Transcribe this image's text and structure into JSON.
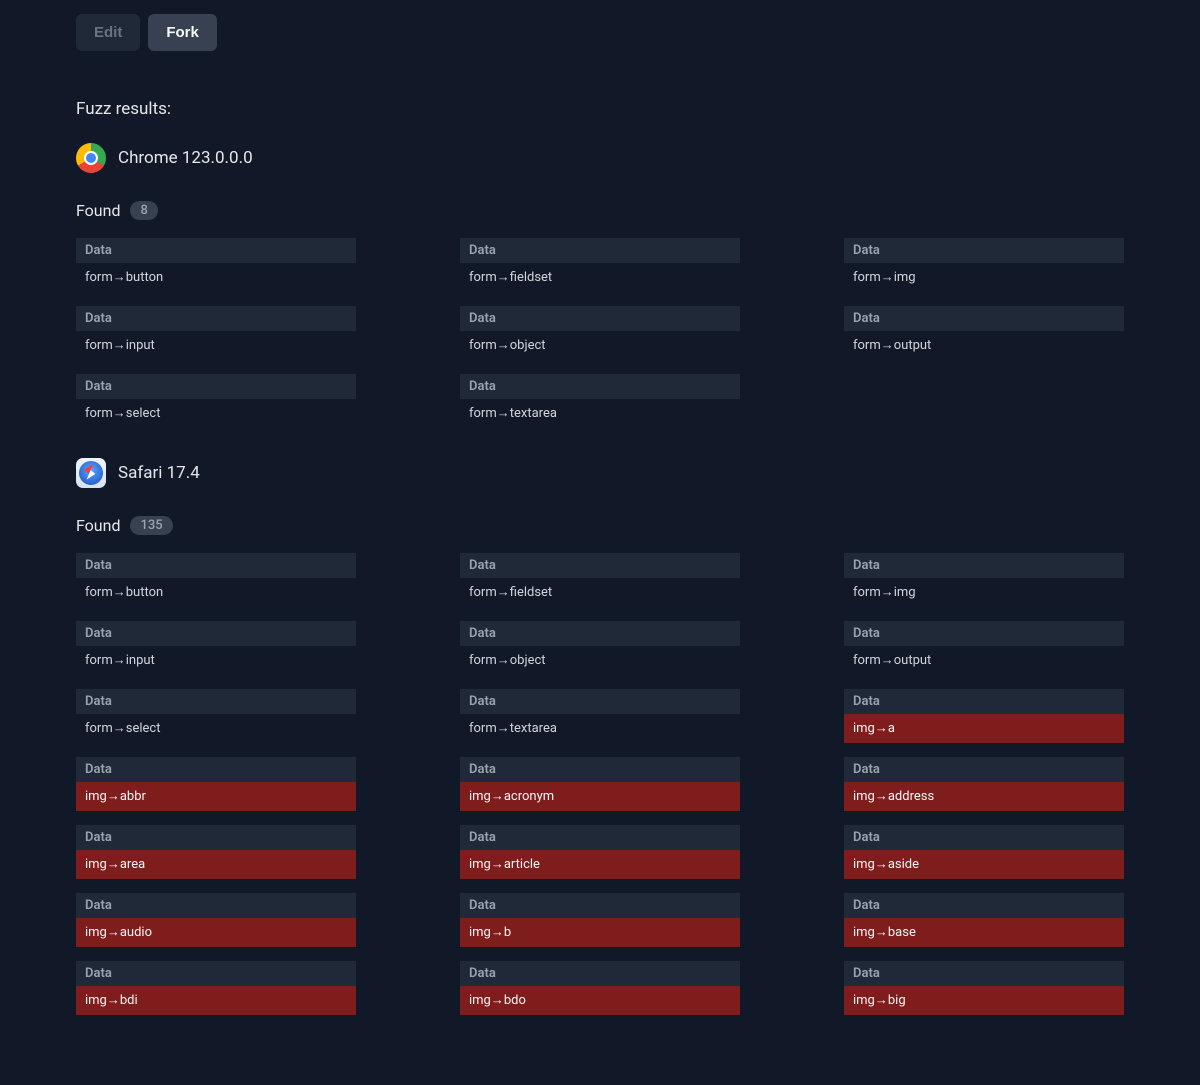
{
  "toolbar": {
    "edit_label": "Edit",
    "fork_label": "Fork"
  },
  "section_title": "Fuzz results:",
  "found_label": "Found",
  "data_label": "Data",
  "browsers": [
    {
      "icon": "chrome",
      "name": "Chrome 123.0.0.0",
      "count": "8",
      "items": [
        {
          "value": "form→button",
          "highlight": false
        },
        {
          "value": "form→fieldset",
          "highlight": false
        },
        {
          "value": "form→img",
          "highlight": false
        },
        {
          "value": "form→input",
          "highlight": false
        },
        {
          "value": "form→object",
          "highlight": false
        },
        {
          "value": "form→output",
          "highlight": false
        },
        {
          "value": "form→select",
          "highlight": false
        },
        {
          "value": "form→textarea",
          "highlight": false
        }
      ]
    },
    {
      "icon": "safari",
      "name": "Safari 17.4",
      "count": "135",
      "items": [
        {
          "value": "form→button",
          "highlight": false
        },
        {
          "value": "form→fieldset",
          "highlight": false
        },
        {
          "value": "form→img",
          "highlight": false
        },
        {
          "value": "form→input",
          "highlight": false
        },
        {
          "value": "form→object",
          "highlight": false
        },
        {
          "value": "form→output",
          "highlight": false
        },
        {
          "value": "form→select",
          "highlight": false
        },
        {
          "value": "form→textarea",
          "highlight": false
        },
        {
          "value": "img→a",
          "highlight": true
        },
        {
          "value": "img→abbr",
          "highlight": true
        },
        {
          "value": "img→acronym",
          "highlight": true
        },
        {
          "value": "img→address",
          "highlight": true
        },
        {
          "value": "img→area",
          "highlight": true
        },
        {
          "value": "img→article",
          "highlight": true
        },
        {
          "value": "img→aside",
          "highlight": true
        },
        {
          "value": "img→audio",
          "highlight": true
        },
        {
          "value": "img→b",
          "highlight": true
        },
        {
          "value": "img→base",
          "highlight": true
        },
        {
          "value": "img→bdi",
          "highlight": true
        },
        {
          "value": "img→bdo",
          "highlight": true
        },
        {
          "value": "img→big",
          "highlight": true
        }
      ]
    }
  ]
}
